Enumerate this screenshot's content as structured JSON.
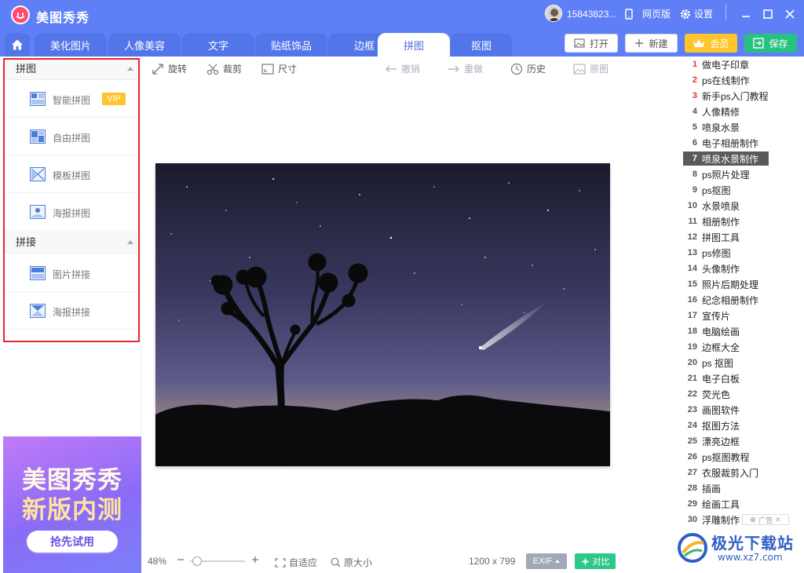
{
  "app": {
    "title": "美图秀秀",
    "user_name": "15843823...",
    "web_version": "网页版",
    "settings": "设置"
  },
  "tabs": [
    {
      "label": "美化图片",
      "active": false
    },
    {
      "label": "人像美容",
      "active": false
    },
    {
      "label": "文字",
      "active": false
    },
    {
      "label": "贴纸饰品",
      "active": false
    },
    {
      "label": "边框",
      "active": false
    },
    {
      "label": "拼图",
      "active": true
    },
    {
      "label": "抠图",
      "active": false
    }
  ],
  "actions": {
    "open": "打开",
    "new": "新建",
    "vip": "会员",
    "save": "保存"
  },
  "left_panel": {
    "section1": {
      "title": "拼图",
      "items": [
        {
          "label": "智能拼图",
          "badge": "VIP",
          "icon": "smart-collage-icon"
        },
        {
          "label": "自由拼图",
          "icon": "free-collage-icon"
        },
        {
          "label": "模板拼图",
          "icon": "template-collage-icon"
        },
        {
          "label": "海报拼图",
          "icon": "poster-collage-icon"
        }
      ]
    },
    "section2": {
      "title": "拼接",
      "items": [
        {
          "label": "图片拼接",
          "icon": "image-stitch-icon"
        },
        {
          "label": "海报拼接",
          "icon": "poster-stitch-icon"
        }
      ]
    }
  },
  "ad_banner": {
    "line1": "美图秀秀",
    "line2": "新版内测",
    "button": "抢先试用"
  },
  "toolbar": {
    "rotate": "旋转",
    "crop": "裁剪",
    "size": "尺寸",
    "undo": "撤销",
    "redo": "重做",
    "history": "历史",
    "original": "原图"
  },
  "status": {
    "zoom": "48%",
    "zoom_level": 0.48,
    "fit": "自适应",
    "original_size": "原大小",
    "dimensions": "1200 x 799",
    "exif": "EXIF",
    "compare": "对比"
  },
  "right_list": [
    {
      "num": "1",
      "text": "做电子印章"
    },
    {
      "num": "2",
      "text": "ps在线制作"
    },
    {
      "num": "3",
      "text": "新手ps入门教程"
    },
    {
      "num": "4",
      "text": "人像精修"
    },
    {
      "num": "5",
      "text": "喷泉水景"
    },
    {
      "num": "6",
      "text": "电子相册制作"
    },
    {
      "num": "7",
      "text": "喷泉水景制作"
    },
    {
      "num": "8",
      "text": "ps照片处理"
    },
    {
      "num": "9",
      "text": "ps抠图"
    },
    {
      "num": "10",
      "text": "水景喷泉"
    },
    {
      "num": "11",
      "text": "相册制作"
    },
    {
      "num": "12",
      "text": "拼图工具"
    },
    {
      "num": "13",
      "text": "ps修图"
    },
    {
      "num": "14",
      "text": "头像制作"
    },
    {
      "num": "15",
      "text": "照片后期处理"
    },
    {
      "num": "16",
      "text": "纪念相册制作"
    },
    {
      "num": "17",
      "text": "宣传片"
    },
    {
      "num": "18",
      "text": "电脑绘画"
    },
    {
      "num": "19",
      "text": "边框大全"
    },
    {
      "num": "20",
      "text": "ps 抠图"
    },
    {
      "num": "21",
      "text": "电子白板"
    },
    {
      "num": "22",
      "text": "荧光色"
    },
    {
      "num": "23",
      "text": "画图软件"
    },
    {
      "num": "24",
      "text": "抠图方法"
    },
    {
      "num": "25",
      "text": "漂亮边框"
    },
    {
      "num": "26",
      "text": "ps抠图教程"
    },
    {
      "num": "27",
      "text": "衣服裁剪入门"
    },
    {
      "num": "28",
      "text": "插画"
    },
    {
      "num": "29",
      "text": "绘画工具"
    },
    {
      "num": "30",
      "text": "浮雕制作"
    }
  ],
  "right_list_active_index": 6,
  "ad_tag": "广告",
  "watermark": {
    "name": "极光下载站",
    "url": "www.xz7.com"
  },
  "colors": {
    "brand_blue": "#5f7ff6",
    "vip_gold": "#ffc52b",
    "save_green": "#27c180",
    "highlight_red": "#e6262a"
  }
}
